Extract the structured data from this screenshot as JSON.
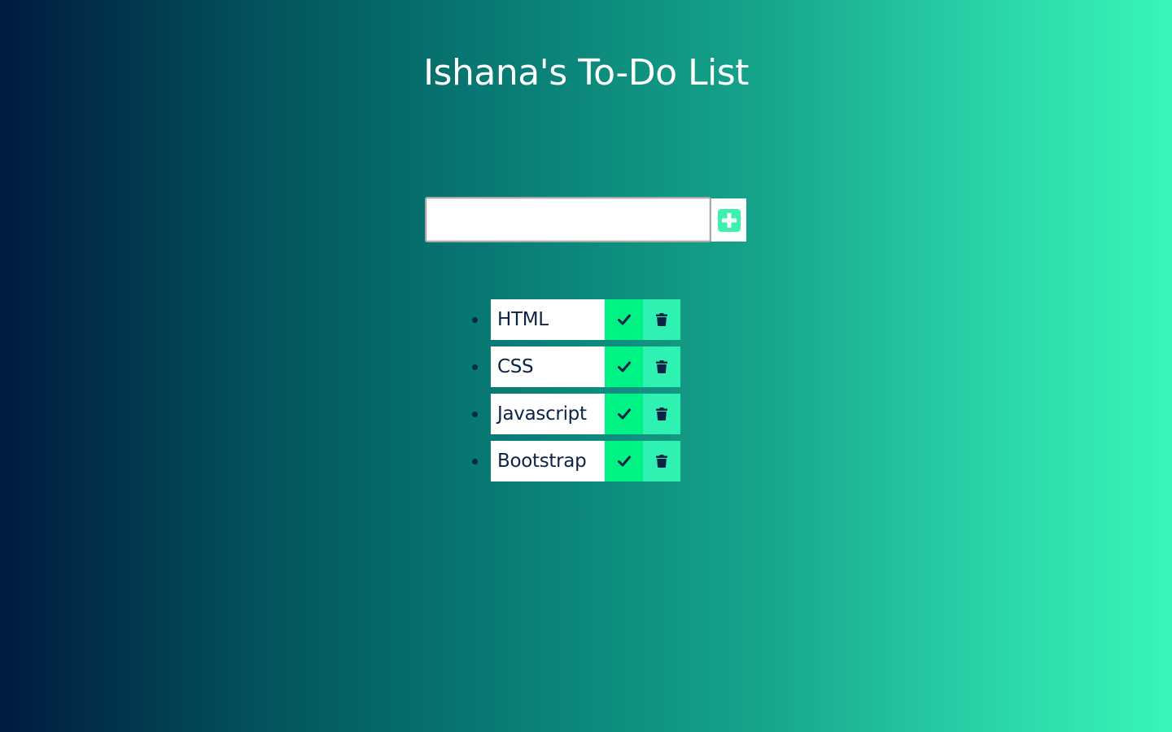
{
  "header": {
    "title": "Ishana's To-Do List"
  },
  "new_task": {
    "value": "",
    "placeholder": "",
    "add_icon": "plus-square-icon"
  },
  "todos": [
    {
      "text": "HTML"
    },
    {
      "text": "CSS"
    },
    {
      "text": "Javascript"
    },
    {
      "text": "Bootstrap"
    }
  ],
  "icons": {
    "complete": "check-icon",
    "delete": "trash-icon"
  },
  "colors": {
    "gradient_left": "#001a40",
    "gradient_right": "#38f6b9",
    "complete_button": "#00f284",
    "delete_button": "#2ff2b2",
    "add_icon": "#3df2b0",
    "text_dark": "#0b2344"
  }
}
